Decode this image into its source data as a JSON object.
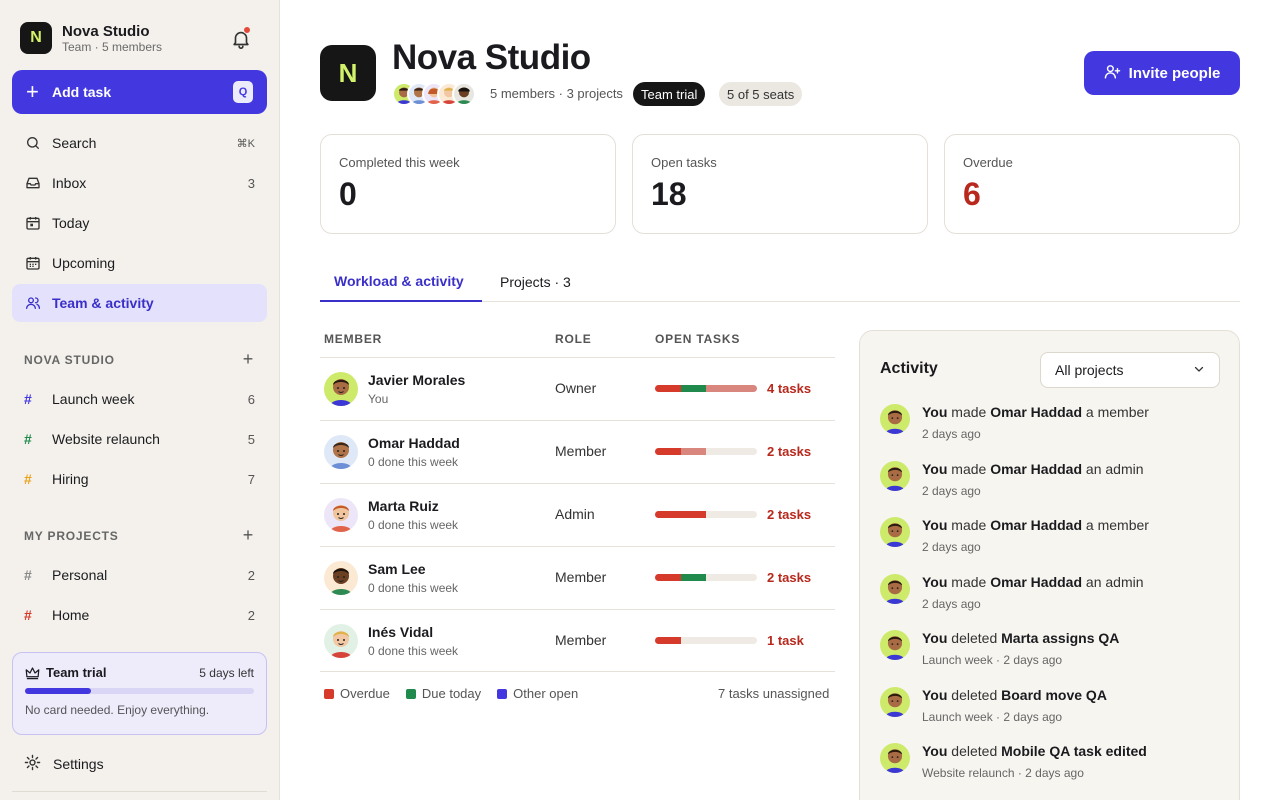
{
  "workspace": {
    "name": "Nova Studio",
    "subtitle": "Team · 5 members",
    "logo_letter": "N"
  },
  "sidebar": {
    "add_task": {
      "label": "Add task",
      "shortcut": "Q"
    },
    "nav": [
      {
        "label": "Search",
        "shortcut": "⌘K",
        "icon": "search-icon"
      },
      {
        "label": "Inbox",
        "count": "3",
        "icon": "inbox-icon"
      },
      {
        "label": "Today",
        "icon": "calendar-today-icon"
      },
      {
        "label": "Upcoming",
        "icon": "calendar-upcoming-icon"
      },
      {
        "label": "Team & activity",
        "icon": "team-icon",
        "active": true
      }
    ],
    "team_section": {
      "title": "NOVA STUDIO",
      "projects": [
        {
          "label": "Launch week",
          "count": "6",
          "color": "#4338e0"
        },
        {
          "label": "Website relaunch",
          "count": "5",
          "color": "#1f8a4c"
        },
        {
          "label": "Hiring",
          "count": "7",
          "color": "#e8a21b"
        }
      ]
    },
    "my_section": {
      "title": "MY PROJECTS",
      "projects": [
        {
          "label": "Personal",
          "count": "2",
          "color": "#888888"
        },
        {
          "label": "Home",
          "count": "2",
          "color": "#d63a2b"
        }
      ]
    },
    "trial": {
      "title": "Team trial",
      "days_left": "5 days left",
      "note": "No card needed. Enjoy everything.",
      "progress": 0.29
    },
    "settings_label": "Settings"
  },
  "header": {
    "title": "Nova Studio",
    "logo_letter": "N",
    "meta": "5 members · 3 projects",
    "trial_pill": "Team trial",
    "seats_pill": "5 of 5 seats",
    "invite_label": "Invite people"
  },
  "stats": [
    {
      "label": "Completed this week",
      "value": "0",
      "color": "#1b1b1f"
    },
    {
      "label": "Open tasks",
      "value": "18",
      "color": "#1b1b1f"
    },
    {
      "label": "Overdue",
      "value": "6",
      "color": "#b8281c"
    }
  ],
  "tabs": [
    {
      "label": "Workload & activity",
      "active": true
    },
    {
      "label": "Projects · 3",
      "active": false
    }
  ],
  "table": {
    "headers": {
      "member": "MEMBER",
      "role": "ROLE",
      "open_tasks": "OPEN TASKS"
    },
    "rows": [
      {
        "name": "Javier Morales",
        "sub": "You",
        "role": "Owner",
        "tasks": "4 tasks",
        "segments": [
          {
            "color": "#d63a2b",
            "fraction": 0.25
          },
          {
            "color": "#1f8a4c",
            "fraction": 0.25
          },
          {
            "color": "#d9877e",
            "fraction": 0.5
          }
        ],
        "avatar_bg": "#cdea6b",
        "skin": "#a86b43"
      },
      {
        "name": "Omar Haddad",
        "sub": "0 done this week",
        "role": "Member",
        "tasks": "2 tasks",
        "segments": [
          {
            "color": "#d63a2b",
            "fraction": 0.25
          },
          {
            "color": "#d9877e",
            "fraction": 0.25
          }
        ],
        "avatar_bg": "#dfe8f7",
        "skin": "#b07448"
      },
      {
        "name": "Marta Ruiz",
        "sub": "0 done this week",
        "role": "Admin",
        "tasks": "2 tasks",
        "segments": [
          {
            "color": "#d63a2b",
            "fraction": 0.5
          }
        ],
        "avatar_bg": "#ece6f8",
        "skin": "#f0c49d"
      },
      {
        "name": "Sam Lee",
        "sub": "0 done this week",
        "role": "Member",
        "tasks": "2 tasks",
        "segments": [
          {
            "color": "#d63a2b",
            "fraction": 0.25
          },
          {
            "color": "#1f8a4c",
            "fraction": 0.25
          }
        ],
        "avatar_bg": "#fbe9d4",
        "skin": "#6b3f22"
      },
      {
        "name": "Inés Vidal",
        "sub": "0 done this week",
        "role": "Member",
        "tasks": "1 task",
        "segments": [
          {
            "color": "#d63a2b",
            "fraction": 0.25
          }
        ],
        "avatar_bg": "#e2f1e6",
        "skin": "#f2c7a3"
      }
    ],
    "legend": [
      {
        "label": "Overdue",
        "color": "#d63a2b"
      },
      {
        "label": "Due today",
        "color": "#1f8a4c"
      },
      {
        "label": "Other open",
        "color": "#4338e0"
      }
    ],
    "unassigned": "7 tasks unassigned"
  },
  "activity": {
    "title": "Activity",
    "filter": "All projects",
    "items": [
      {
        "actor": "You",
        "verb": " made ",
        "object": "Omar Haddad",
        "suffix": " a member",
        "meta": "2 days ago"
      },
      {
        "actor": "You",
        "verb": " made ",
        "object": "Omar Haddad",
        "suffix": " an admin",
        "meta": "2 days ago"
      },
      {
        "actor": "You",
        "verb": " made ",
        "object": "Omar Haddad",
        "suffix": " a member",
        "meta": "2 days ago"
      },
      {
        "actor": "You",
        "verb": " made ",
        "object": "Omar Haddad",
        "suffix": " an admin",
        "meta": "2 days ago"
      },
      {
        "actor": "You",
        "verb": " deleted ",
        "object": "Marta assigns QA",
        "suffix": "",
        "meta": "Launch week · 2 days ago"
      },
      {
        "actor": "You",
        "verb": " deleted ",
        "object": "Board move QA",
        "suffix": "",
        "meta": "Launch week · 2 days ago"
      },
      {
        "actor": "You",
        "verb": " deleted ",
        "object": "Mobile QA task edited",
        "suffix": "",
        "meta": "Website relaunch · 2 days ago"
      }
    ]
  }
}
